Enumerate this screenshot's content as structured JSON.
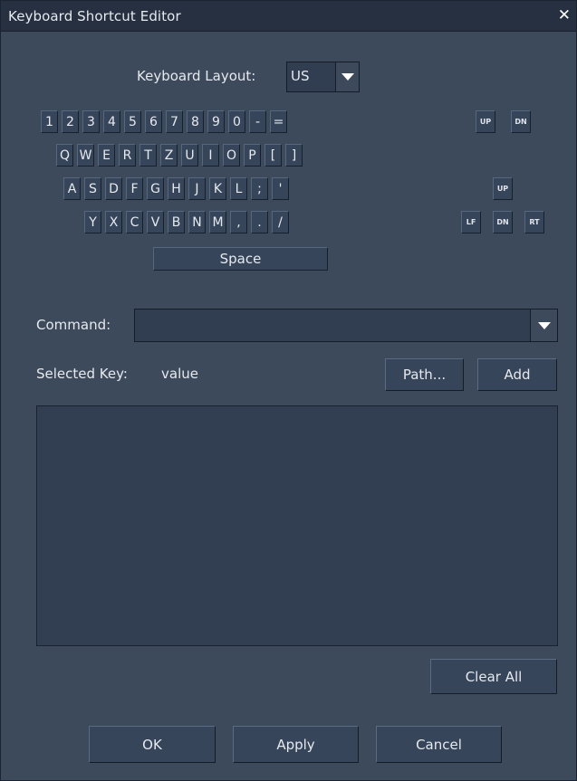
{
  "window": {
    "title": "Keyboard Shortcut Editor",
    "close_glyph": "✕"
  },
  "layout_selector": {
    "label": "Keyboard Layout:",
    "value": "US"
  },
  "keyboard": {
    "row1": [
      "1",
      "2",
      "3",
      "4",
      "5",
      "6",
      "7",
      "8",
      "9",
      "0",
      "-",
      "="
    ],
    "row2": [
      "Q",
      "W",
      "E",
      "R",
      "T",
      "Z",
      "U",
      "I",
      "O",
      "P",
      "[",
      "]"
    ],
    "row3": [
      "A",
      "S",
      "D",
      "F",
      "G",
      "H",
      "J",
      "K",
      "L",
      ";",
      "'"
    ],
    "row4": [
      "Y",
      "X",
      "C",
      "V",
      "B",
      "N",
      "M",
      ",",
      ".",
      "/"
    ],
    "space": "Space",
    "page_keys": {
      "up": "UP",
      "down": "DN"
    },
    "arrow_keys": {
      "up": "UP",
      "left": "LF",
      "down": "DN",
      "right": "RT"
    }
  },
  "command": {
    "label": "Command:",
    "value": ""
  },
  "selected_key": {
    "label": "Selected Key:",
    "value": "value"
  },
  "buttons": {
    "path": "Path...",
    "add": "Add",
    "clear_all": "Clear All",
    "ok": "OK",
    "apply": "Apply",
    "cancel": "Cancel"
  },
  "shortcut_list": {
    "items": []
  }
}
